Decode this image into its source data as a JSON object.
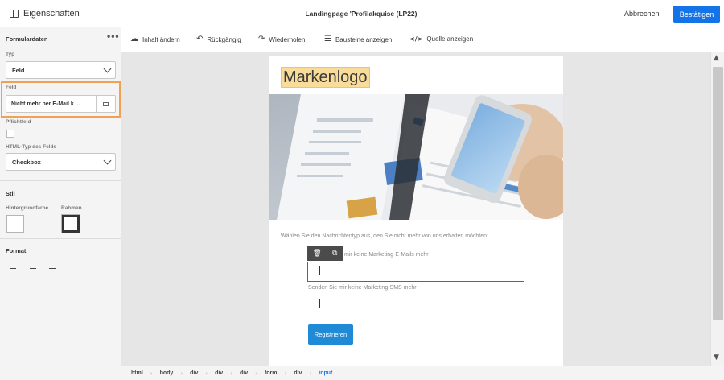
{
  "header": {
    "properties_label": "Eigenschaften",
    "title": "Landingpage 'Profilakquise (LP22)'",
    "cancel_label": "Abbrechen",
    "confirm_label": "Bestätigen"
  },
  "left_panel": {
    "section_form": "Formulardaten",
    "more_icon": "more-horizontal-icon",
    "type_label": "Typ",
    "type_value": "Feld",
    "field_label": "Feld",
    "field_value": "Nicht mehr per E-Mail k ...",
    "required_label": "Pflichtfeld",
    "html_type_label": "HTML-Typ des Felds",
    "html_type_value": "Checkbox",
    "section_style": "Stil",
    "bg_color_label": "Hintergrundfarbe",
    "border_label": "Rahmen",
    "section_format": "Format"
  },
  "toolbar": {
    "edit_content": "Inhalt ändern",
    "undo": "Rückgängig",
    "redo": "Wiederholen",
    "show_blocks": "Bausteine anzeigen",
    "show_source": "Quelle anzeigen"
  },
  "page": {
    "logo_text": "Markenlogo",
    "prompt": "Wählen Sie den Nachrichtentyp aus, den Sie nicht mehr von uns erhalten möchten:",
    "option1_label": "mir keine Marketing-E-Mails mehr",
    "option2_label": "Senden Sie mir keine Marketing-SMS mehr",
    "submit_label": "Registrieren"
  },
  "breadcrumbs": [
    "html",
    "body",
    "div",
    "div",
    "div",
    "form",
    "div",
    "input"
  ],
  "colors": {
    "accent": "#1473e6",
    "highlight": "#f0a153",
    "logo_bg": "#f9dc9a",
    "submit": "#1f8ad6"
  }
}
